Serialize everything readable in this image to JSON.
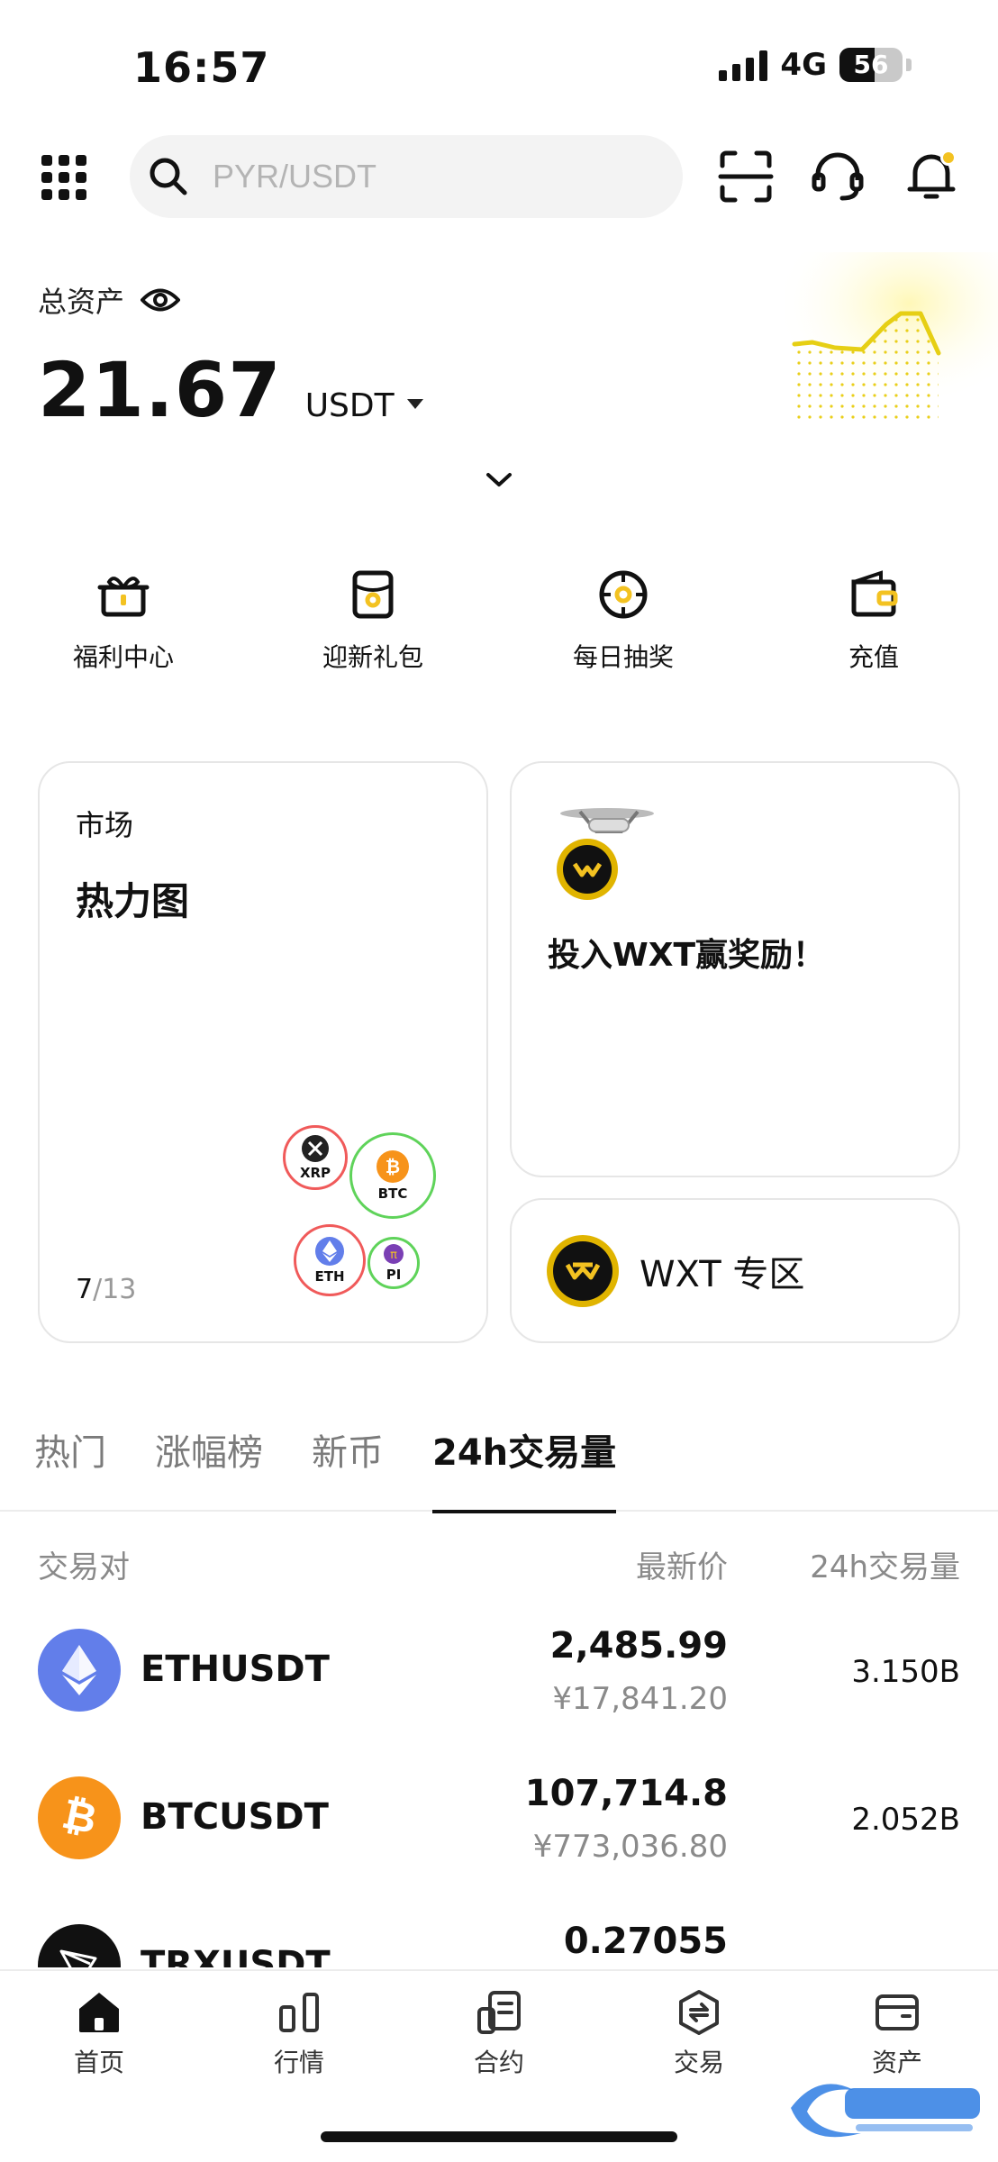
{
  "status_bar": {
    "time": "16:57",
    "network": "4G",
    "battery": "56",
    "battery_level": 0.56
  },
  "search": {
    "placeholder": "PYR/USDT"
  },
  "header_icons": [
    "menu-grid-icon",
    "scan-icon",
    "support-headset-icon",
    "bell-icon"
  ],
  "assets": {
    "label": "总资产",
    "value": "21.67",
    "currency": "USDT"
  },
  "quick_actions": [
    {
      "label": "福利中心",
      "icon": "gift-icon"
    },
    {
      "label": "迎新礼包",
      "icon": "welcome-package-icon"
    },
    {
      "label": "每日抽奖",
      "icon": "lucky-wheel-icon"
    },
    {
      "label": "充值",
      "icon": "wallet-icon"
    }
  ],
  "market_card": {
    "small_title": "市场",
    "title": "热力图",
    "page_current": "7",
    "page_total": "/13",
    "coins": [
      "XRP",
      "BTC",
      "ETH",
      "PI"
    ]
  },
  "promo_card": {
    "text": "投入WXT赢奖励！"
  },
  "zone_card": {
    "label": "WXT 专区"
  },
  "tabs": [
    "热门",
    "涨幅榜",
    "新币",
    "24h交易量"
  ],
  "active_tab": "24h交易量",
  "table": {
    "headers": {
      "pair": "交易对",
      "price": "最新价",
      "volume": "24h交易量"
    },
    "rows": [
      {
        "pair": "ETHUSDT",
        "price": "2,485.99",
        "cny": "¥17,841.20",
        "volume": "3.150B",
        "icon": "ethereum-icon"
      },
      {
        "pair": "BTCUSDT",
        "price": "107,714.8",
        "cny": "¥773,036.80",
        "volume": "2.052B",
        "icon": "bitcoin-icon"
      },
      {
        "pair": "TRXUSDT",
        "price": "0.27055",
        "cny": "",
        "volume": "",
        "icon": "tron-icon"
      }
    ]
  },
  "bottom_nav": [
    {
      "label": "首页",
      "icon": "home-icon"
    },
    {
      "label": "行情",
      "icon": "market-icon"
    },
    {
      "label": "合约",
      "icon": "contract-icon"
    },
    {
      "label": "交易",
      "icon": "trade-icon"
    },
    {
      "label": "资产",
      "icon": "assets-wallet-icon"
    }
  ],
  "colors": {
    "accent": "#f3d316",
    "text": "#111111",
    "muted": "#8a8a8a"
  }
}
